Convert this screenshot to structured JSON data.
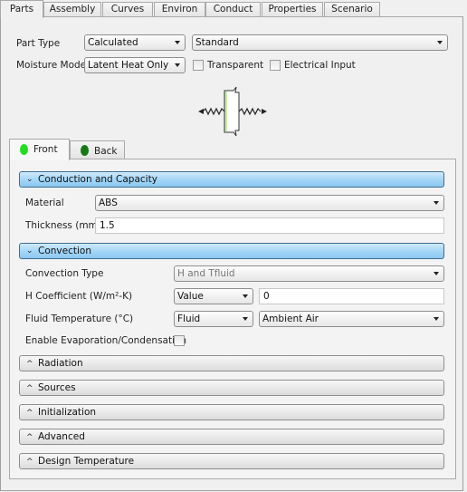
{
  "tabs": [
    {
      "label": "Parts",
      "active": true
    },
    {
      "label": "Assembly",
      "active": false
    },
    {
      "label": "Curves",
      "active": false
    },
    {
      "label": "Environ",
      "active": false
    },
    {
      "label": "Conduct",
      "active": false
    },
    {
      "label": "Properties",
      "active": false
    },
    {
      "label": "Scenario",
      "active": false
    }
  ],
  "part": {
    "part_type_label": "Part Type",
    "part_type_value": "Calculated",
    "part_subtype_value": "Standard",
    "moisture_model_label": "Moisture Model",
    "moisture_model_value": "Latent Heat Only",
    "transparent_label": "Transparent",
    "transparent_checked": false,
    "electrical_input_label": "Electrical Input",
    "electrical_input_checked": false
  },
  "diagram": {
    "icon": "wall-heat-transfer-icon"
  },
  "side_tabs": [
    {
      "label": "Front",
      "active": true,
      "indicator_color": "#22dd22"
    },
    {
      "label": "Back",
      "active": false,
      "indicator_color": "#137a13"
    }
  ],
  "sections": {
    "conduction": {
      "title": "Conduction and Capacity",
      "expanded": true,
      "material_label": "Material",
      "material_value": "ABS",
      "thickness_label": "Thickness (mm)",
      "thickness_value": "1.5"
    },
    "convection": {
      "title": "Convection",
      "expanded": true,
      "type_label": "Convection Type",
      "type_value": "H and Tfluid",
      "h_coeff_label": "H Coefficient (W/m²-K)",
      "h_coeff_mode": "Value",
      "h_coeff_value": "0",
      "fluid_temp_label": "Fluid Temperature (°C)",
      "fluid_temp_mode": "Fluid",
      "fluid_temp_value": "Ambient Air",
      "evap_label": "Enable Evaporation/Condensation",
      "evap_checked": false
    },
    "collapsed": [
      {
        "title": "Radiation"
      },
      {
        "title": "Sources"
      },
      {
        "title": "Initialization"
      },
      {
        "title": "Advanced"
      },
      {
        "title": "Design Temperature"
      }
    ]
  },
  "colors": {
    "section_open": "#9ed3f6",
    "front_indicator": "#22dd22",
    "back_indicator": "#137a13"
  }
}
